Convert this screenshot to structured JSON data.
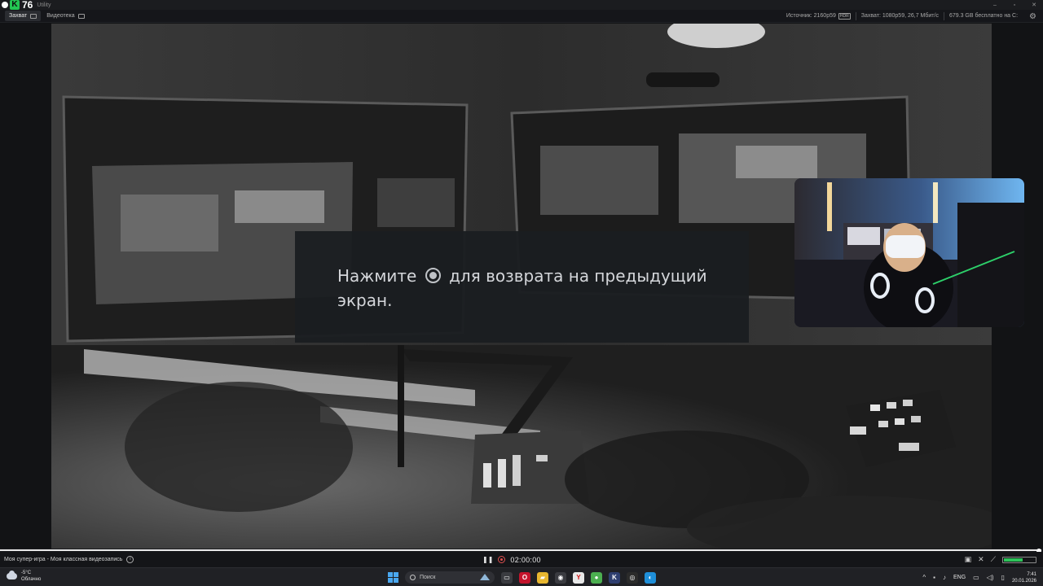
{
  "app": {
    "logo_letter": "K",
    "logo_number": "76",
    "title": "Utility"
  },
  "window_controls": {
    "minimize": "–",
    "maximize": "▫",
    "close": "✕"
  },
  "tabs": [
    {
      "label": "Захват",
      "active": true
    },
    {
      "label": "Видеотека",
      "active": false
    }
  ],
  "status": {
    "source": "Источник: 2160p59",
    "hdr": "HDR",
    "capture": "Захват: 1080p59, 26,7 Мбит/с",
    "storage": "679.3 GB бесплатно на C:"
  },
  "dialog": {
    "text_before": "Нажмите",
    "text_after": "для возврата на предыдущий экран."
  },
  "recording": {
    "name": "Моя супер-игра - Моя классная видеозапись",
    "timer": "02:00:00",
    "progress": 1.0
  },
  "gauge": {
    "level": 0.6,
    "color": "#2ec45a"
  },
  "taskbar": {
    "weather_temp": "-5°C",
    "weather_desc": "Облачно",
    "search_placeholder": "Поиск",
    "language": "ENG",
    "time": "7:41",
    "date": "20.01.2026",
    "apps": [
      {
        "name": "file-manager-icon",
        "glyph": "▭",
        "color": "#3a3b40"
      },
      {
        "name": "opera-icon",
        "glyph": "O",
        "color": "#c3142c"
      },
      {
        "name": "folder-icon",
        "glyph": "▰",
        "color": "#e8b730"
      },
      {
        "name": "recorder-icon",
        "glyph": "◉",
        "color": "#3a3b40"
      },
      {
        "name": "yandex-icon",
        "glyph": "Y",
        "color": "#e8e8e8"
      },
      {
        "name": "chat-icon",
        "glyph": "●",
        "color": "#4caf50"
      },
      {
        "name": "capture-app-icon",
        "glyph": "K",
        "color": "#2f3f70"
      },
      {
        "name": "obs-icon",
        "glyph": "◎",
        "color": "#2b2b2b"
      },
      {
        "name": "browser-icon",
        "glyph": "◐",
        "color": "#1f8fd9"
      }
    ]
  },
  "colors": {
    "accent": "#23c552",
    "record": "#e05050"
  }
}
